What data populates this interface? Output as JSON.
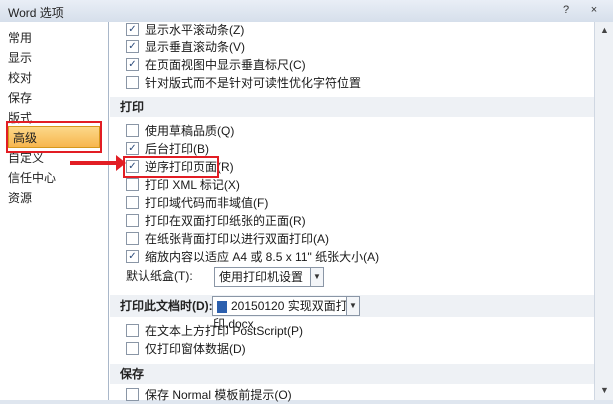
{
  "window": {
    "title": "Word 选项",
    "help_button": "?",
    "close_button": "×"
  },
  "sidebar": {
    "items": [
      {
        "label": "常用"
      },
      {
        "label": "显示"
      },
      {
        "label": "校对"
      },
      {
        "label": "保存"
      },
      {
        "label": "版式"
      },
      {
        "label": "高级"
      },
      {
        "label": "自定义"
      },
      {
        "label": "信任中心"
      },
      {
        "label": "资源"
      }
    ],
    "selected": "高级"
  },
  "display_options": [
    {
      "label": "显示水平滚动条(Z)",
      "checked": true
    },
    {
      "label": "显示垂直滚动条(V)",
      "checked": true
    },
    {
      "label": "在页面视图中显示垂直标尺(C)",
      "checked": true
    },
    {
      "label": "针对版式而不是针对可读性优化字符位置",
      "checked": false
    }
  ],
  "print_section": {
    "title": "打印",
    "options": [
      {
        "label": "使用草稿品质(Q)",
        "checked": false
      },
      {
        "label": "后台打印(B)",
        "checked": true
      },
      {
        "label": "逆序打印页面(R)",
        "checked": true
      },
      {
        "label": "打印 XML 标记(X)",
        "checked": false
      },
      {
        "label": "打印域代码而非域值(F)",
        "checked": false
      },
      {
        "label": "打印在双面打印纸张的正面(R)",
        "checked": false
      },
      {
        "label": "在纸张背面打印以进行双面打印(A)",
        "checked": false
      },
      {
        "label": "缩放内容以适应 A4 或 8.5 x 11\" 纸张大小(A)",
        "checked": true
      }
    ],
    "default_tray_label": "默认纸盒(T):",
    "default_tray_value": "使用打印机设置"
  },
  "doc_print_section": {
    "title": "打印此文档时(D):",
    "document": "20150120 实现双面打印.docx",
    "options": [
      {
        "label": "在文本上方打印 PostScript(P)",
        "checked": false
      },
      {
        "label": "仅打印窗体数据(D)",
        "checked": false
      }
    ]
  },
  "save_section": {
    "title": "保存",
    "options": [
      {
        "label": "保存 Normal 模板前提示(O)",
        "checked": false
      }
    ]
  },
  "colors": {
    "highlight_red": "#e21d24",
    "selected_nav": "#f7b64e"
  }
}
